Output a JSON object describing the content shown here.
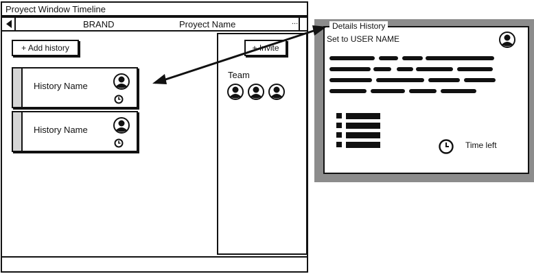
{
  "window": {
    "title": "Proyect Window Timeline"
  },
  "nav": {
    "brand": "BRAND",
    "project_name": "Proyect Name",
    "more": "..."
  },
  "toolbar": {
    "add_history_label": "+ Add history",
    "invite_label": "+ Invite"
  },
  "histories": [
    {
      "name": "History Name"
    },
    {
      "name": "History Name"
    }
  ],
  "team": {
    "label": "Team",
    "member_count": 3
  },
  "details": {
    "legend": "Details History",
    "set_to": "Set to USER NAME",
    "time_left": "Time left"
  },
  "icons": {
    "avatar": "user-avatar-icon",
    "clock": "clock-icon",
    "back": "back-arrow-icon",
    "list": "list-icon"
  }
}
